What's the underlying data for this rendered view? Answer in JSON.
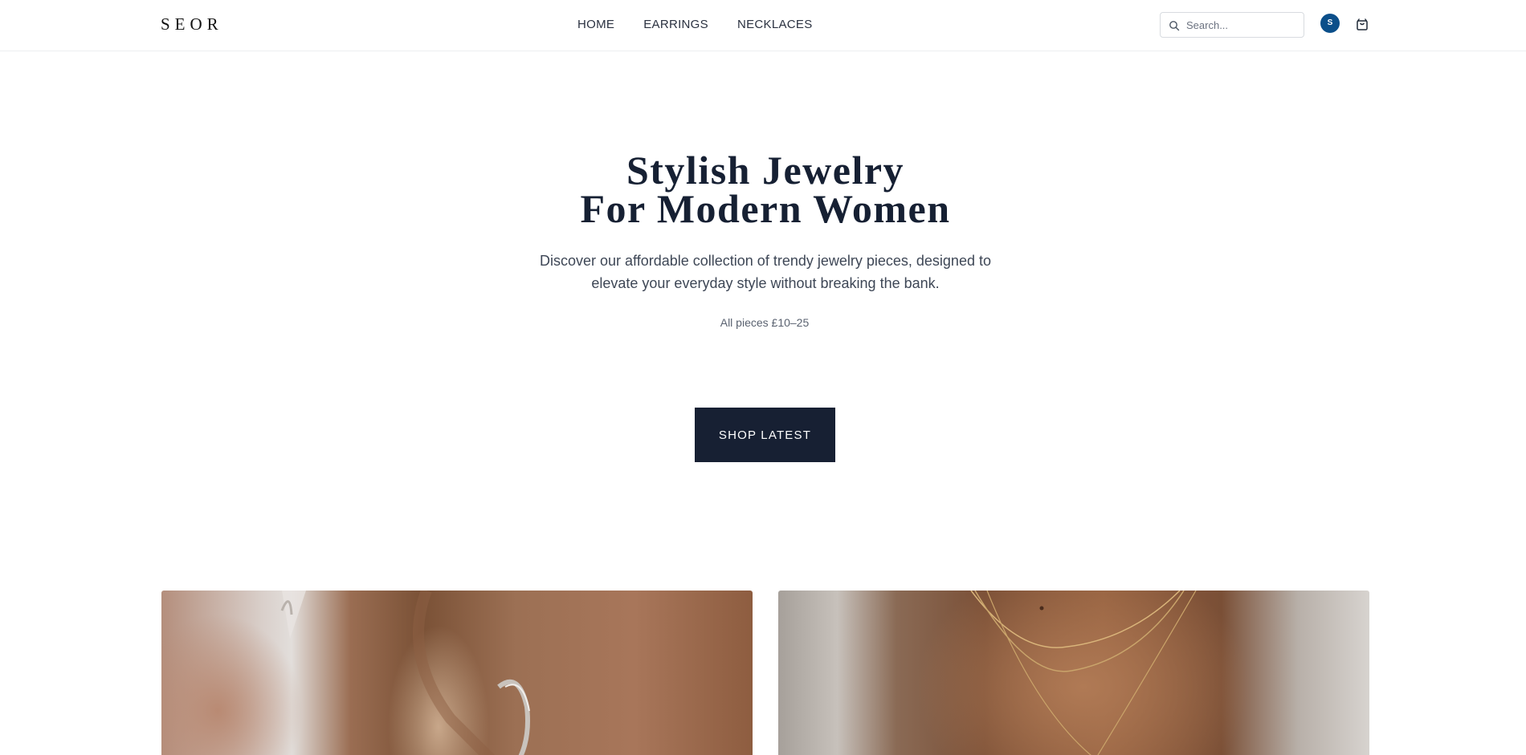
{
  "header": {
    "logo": "SEOR",
    "nav": [
      {
        "label": "HOME"
      },
      {
        "label": "EARRINGS"
      },
      {
        "label": "NECKLACES"
      }
    ],
    "search_placeholder": "Search...",
    "avatar_initial": "S",
    "icons": {
      "search": "search-icon",
      "cart": "shopping-bag-icon"
    },
    "accent_color": "#0b4f8a"
  },
  "hero": {
    "title_line1": "Stylish Jewelry",
    "title_line2": "For Modern Women",
    "description": "Discover our affordable collection of trendy jewelry pieces, designed to elevate your everyday style without breaking the bank.",
    "price_note": "All pieces £10–25",
    "cta_label": "SHOP LATEST",
    "cta_color": "#172033"
  },
  "features": [
    {
      "name": "earrings-photo"
    },
    {
      "name": "necklaces-photo"
    }
  ]
}
